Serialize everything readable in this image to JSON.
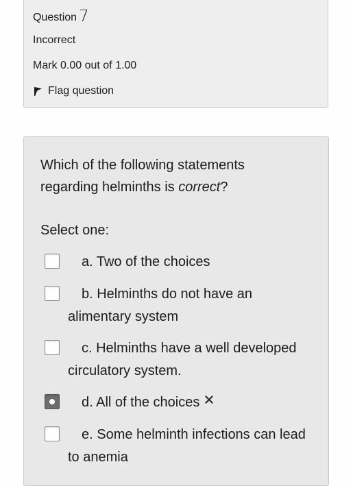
{
  "info": {
    "question_label": "Question",
    "question_number": "7",
    "status": "Incorrect",
    "mark": "Mark 0.00 out of 1.00",
    "flag_label": "Flag question"
  },
  "question": {
    "text_before": "Which of the following statements regarding helminths is ",
    "text_emph": "correct",
    "text_after": "?",
    "select_label": "Select one:",
    "choices": [
      {
        "label": "a. Two of the choices",
        "checked": false
      },
      {
        "label": "b. Helminths do not have an alimentary system",
        "checked": false
      },
      {
        "label": "c. Helminths have a well developed circulatory system.",
        "checked": false
      },
      {
        "label": "d. All of the choices",
        "checked": true,
        "feedback_icon": "incorrect-x-icon"
      },
      {
        "label": "e. Some helminth infections can lead to anemia",
        "checked": false
      }
    ]
  }
}
